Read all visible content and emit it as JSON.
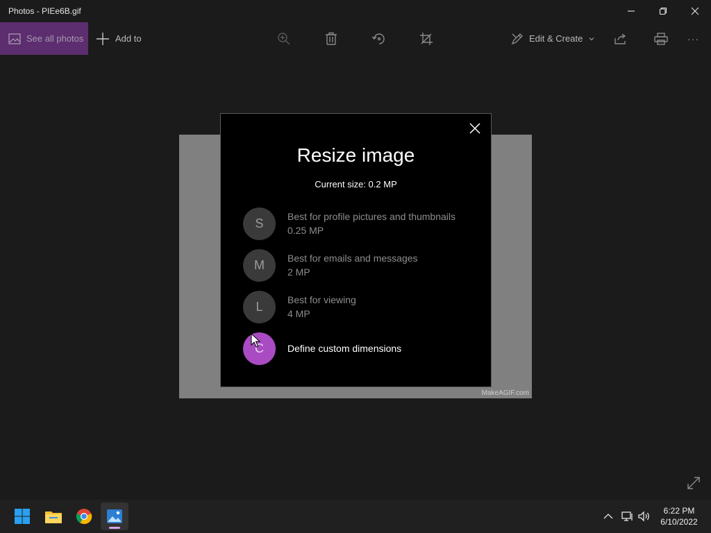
{
  "window": {
    "title": "Photos - PIEe6B.gif"
  },
  "toolbar": {
    "see_all_label": "See all photos",
    "add_to_label": "Add to",
    "edit_create_label": "Edit & Create",
    "more_label": "···"
  },
  "image": {
    "watermark": "MakeAGIF.com"
  },
  "dialog": {
    "title": "Resize image",
    "current_size": "Current size: 0.2 MP",
    "options": [
      {
        "letter": "S",
        "description": "Best for profile pictures and thumbnails",
        "size": "0.25 MP"
      },
      {
        "letter": "M",
        "description": "Best for emails and messages",
        "size": "2 MP"
      },
      {
        "letter": "L",
        "description": "Best for viewing",
        "size": "4 MP"
      },
      {
        "letter": "C",
        "description": "Define custom dimensions",
        "size": ""
      }
    ]
  },
  "taskbar": {
    "time": "6:22 PM",
    "date": "6/10/2022"
  },
  "colors": {
    "accent": "#a94bc2",
    "see_all_bg": "#5c2d6f",
    "dialog_bg": "#000000",
    "app_bg": "#1b1b1b"
  }
}
